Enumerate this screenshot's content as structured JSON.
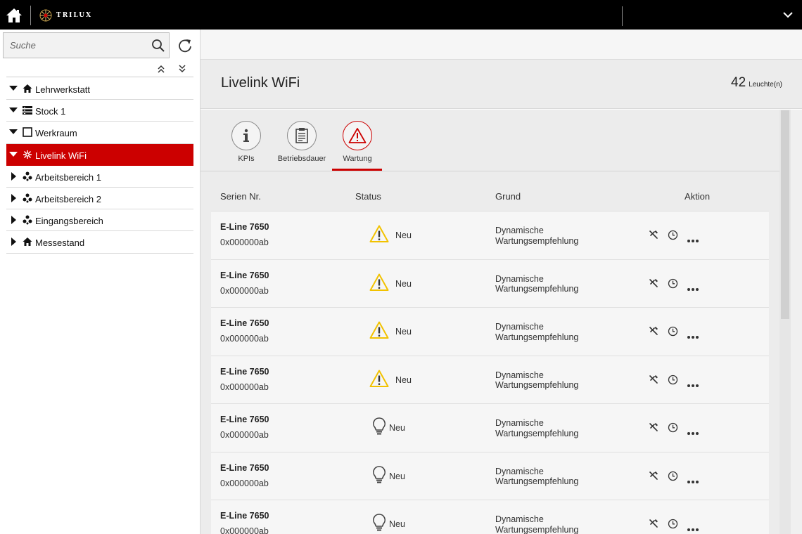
{
  "colors": {
    "accent": "#cc0000",
    "warning": "#f2c200",
    "topbar": "#000000"
  },
  "topbar": {
    "brand": "TRILUX",
    "home_icon": "home-icon",
    "menu_icon": "chevron-down-icon"
  },
  "sidebar": {
    "search_placeholder": "Suche",
    "tree": [
      {
        "label": "Lehrwerkstatt",
        "icon": "home-icon",
        "expanded": true,
        "level": 0
      },
      {
        "label": "Stock 1",
        "icon": "floor-icon",
        "expanded": true,
        "level": 0
      },
      {
        "label": "Werkraum",
        "icon": "room-icon",
        "expanded": true,
        "level": 0
      },
      {
        "label": "Livelink WiFi",
        "icon": "gateway-icon",
        "expanded": true,
        "level": 0,
        "active": true
      },
      {
        "label": "Arbeitsbereich 1",
        "icon": "zone-icon",
        "expanded": false,
        "level": 0
      },
      {
        "label": "Arbeitsbereich 2",
        "icon": "zone-icon",
        "expanded": false,
        "level": 0
      },
      {
        "label": "Eingangsbereich",
        "icon": "zone-icon",
        "expanded": false,
        "level": 0
      },
      {
        "label": "Messestand",
        "icon": "home-icon",
        "expanded": false,
        "level": 0
      }
    ]
  },
  "header": {
    "title": "Livelink WiFi",
    "count": "42",
    "count_unit": "Leuchte(n)"
  },
  "tabs": [
    {
      "label": "KPIs",
      "icon": "info-icon"
    },
    {
      "label": "Betriebsdauer",
      "icon": "clipboard-icon"
    },
    {
      "label": "Wartung",
      "icon": "warning-icon",
      "active": true
    }
  ],
  "table": {
    "columns": {
      "serial": "Serien Nr.",
      "status": "Status",
      "reason": "Grund",
      "action": "Aktion"
    },
    "rows": [
      {
        "name": "E-Line 7650",
        "serial": "0x000000ab",
        "status": "Neu",
        "status_icon": "warning-icon",
        "reason_line1": "Dynamische",
        "reason_line2": "Wartungsempfehlung"
      },
      {
        "name": "E-Line 7650",
        "serial": "0x000000ab",
        "status": "Neu",
        "status_icon": "warning-icon",
        "reason_line1": "Dynamische",
        "reason_line2": "Wartungsempfehlung"
      },
      {
        "name": "E-Line 7650",
        "serial": "0x000000ab",
        "status": "Neu",
        "status_icon": "warning-icon",
        "reason_line1": "Dynamische",
        "reason_line2": "Wartungsempfehlung"
      },
      {
        "name": "E-Line 7650",
        "serial": "0x000000ab",
        "status": "Neu",
        "status_icon": "warning-icon",
        "reason_line1": "Dynamische",
        "reason_line2": "Wartungsempfehlung"
      },
      {
        "name": "E-Line 7650",
        "serial": "0x000000ab",
        "status": "Neu",
        "status_icon": "bulb-icon",
        "reason_line1": "Dynamische",
        "reason_line2": "Wartungsempfehlung"
      },
      {
        "name": "E-Line 7650",
        "serial": "0x000000ab",
        "status": "Neu",
        "status_icon": "bulb-icon",
        "reason_line1": "Dynamische",
        "reason_line2": "Wartungsempfehlung"
      },
      {
        "name": "E-Line 7650",
        "serial": "0x000000ab",
        "status": "Neu",
        "status_icon": "bulb-icon",
        "reason_line1": "Dynamische",
        "reason_line2": "Wartungsempfehlung"
      }
    ]
  }
}
